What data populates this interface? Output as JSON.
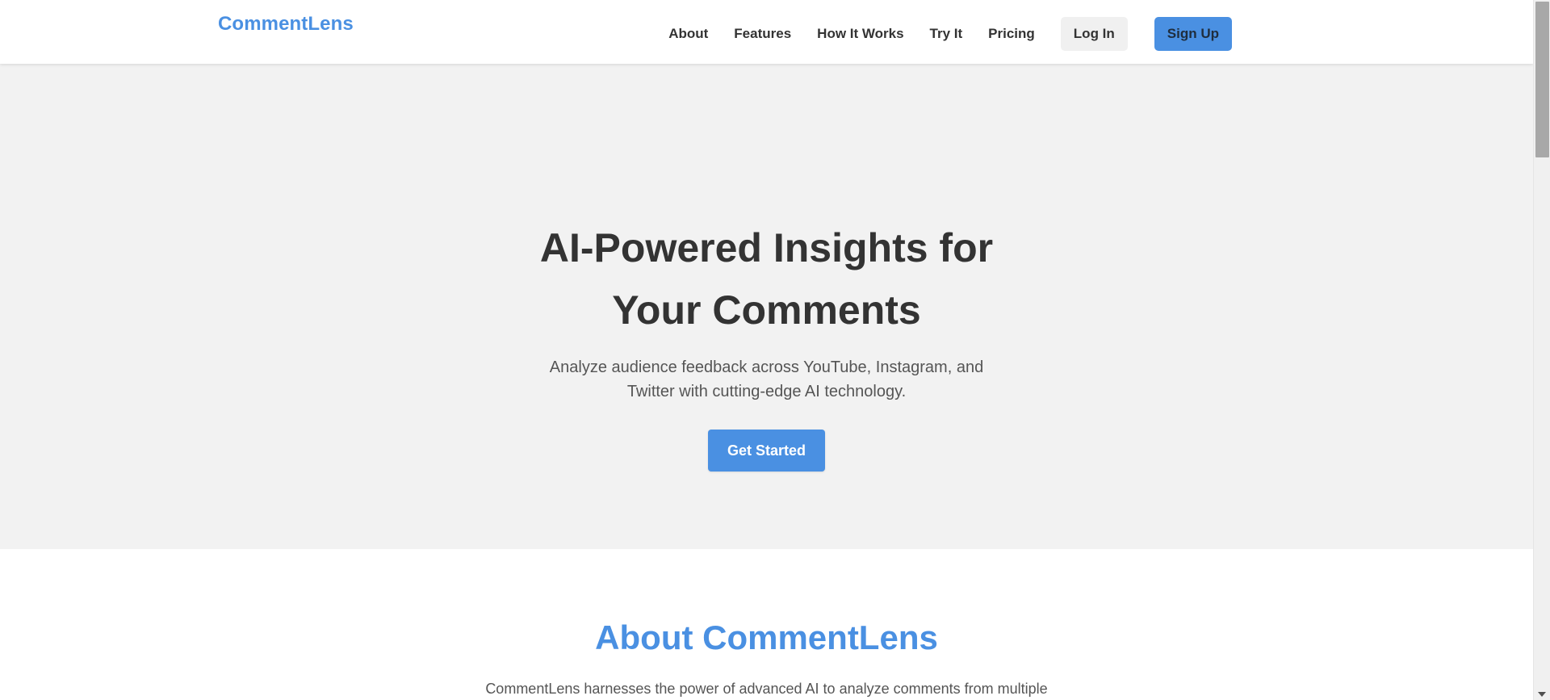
{
  "header": {
    "logo": "CommentLens",
    "nav": [
      "About",
      "Features",
      "How It Works",
      "Try It",
      "Pricing"
    ],
    "login_label": "Log In",
    "signup_label": "Sign Up"
  },
  "hero": {
    "title_line1": "AI-Powered Insights for",
    "title_line2": "Your Comments",
    "subtitle": "Analyze audience feedback across YouTube, Instagram, and Twitter with cutting-edge AI technology.",
    "cta_label": "Get Started"
  },
  "about": {
    "title": "About CommentLens",
    "text": "CommentLens harnesses the power of advanced AI to analyze comments from multiple"
  },
  "colors": {
    "accent": "#4a90e2",
    "hero_bg": "#f2f2f2",
    "text": "#333333"
  }
}
